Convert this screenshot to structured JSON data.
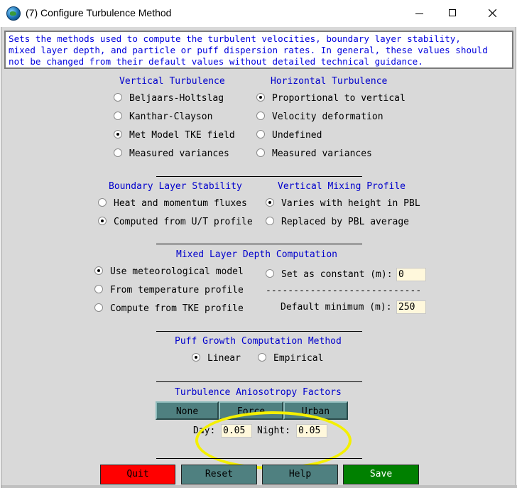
{
  "window": {
    "title": "(7) Configure Turbulence Method"
  },
  "info_lines": [
    "Sets the methods used to compute the turbulent velocities, boundary layer stability,",
    "mixed layer depth, and particle or puff dispersion rates. In general, these values should",
    "not be changed from their default values without detailed technical guidance."
  ],
  "vertical_turbulence": {
    "header": "Vertical Turbulence",
    "options": [
      "Beljaars-Holtslag",
      "Kanthar-Clayson",
      "Met Model TKE field",
      "Measured variances"
    ],
    "selected_index": 2
  },
  "horizontal_turbulence": {
    "header": "Horizontal Turbulence",
    "options": [
      "Proportional to vertical",
      "Velocity deformation",
      "Undefined",
      "Measured variances"
    ],
    "selected_index": 0
  },
  "boundary_layer_stability": {
    "header": "Boundary Layer Stability",
    "options": [
      "Heat and momentum fluxes",
      "Computed from U/T profile"
    ],
    "selected_index": 1
  },
  "vertical_mixing_profile": {
    "header": "Vertical Mixing Profile",
    "options": [
      "Varies with height in PBL",
      "Replaced by PBL average"
    ],
    "selected_index": 0
  },
  "mixed_layer_depth": {
    "header": "Mixed Layer Depth Computation",
    "options": [
      "Use meteorological model",
      "From temperature profile",
      "Compute from TKE profile"
    ],
    "selected_index": 0,
    "constant_option": "Set as constant (m):",
    "constant_value": "0",
    "dashes": "----------------------------",
    "default_min_label": "Default minimum (m):",
    "default_min_value": "250"
  },
  "puff_growth": {
    "header": "Puff Growth Computation Method",
    "options": [
      "Linear",
      "Empirical"
    ],
    "selected_index": 0
  },
  "anisotropy": {
    "header": "Turbulence Aniosotropy Factors",
    "buttons": [
      "None",
      "Force",
      "Urban"
    ],
    "day_label": "Day:",
    "day_value": "0.05",
    "night_label": "Night:",
    "night_value": "0.05"
  },
  "actions": {
    "quit": "Quit",
    "reset": "Reset",
    "help": "Help",
    "save": "Save"
  },
  "colors": {
    "header_text": "#0000cc",
    "info_text": "#0000dd",
    "dialog_bg": "#d9d9d9",
    "teal_button": "#4f8080",
    "quit_button": "#ff0000",
    "save_button": "#008000",
    "field_bg": "#fff8dc",
    "highlight": "#f4f000"
  }
}
